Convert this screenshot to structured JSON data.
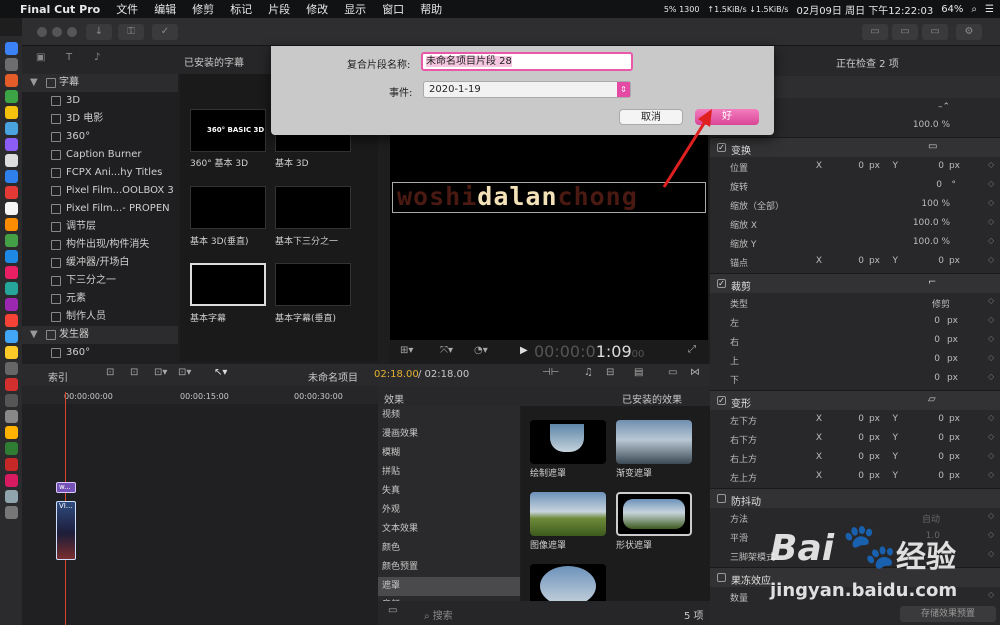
{
  "menubar": {
    "apple": "",
    "app": "Final Cut Pro",
    "items": [
      "文件",
      "编辑",
      "修剪",
      "标记",
      "片段",
      "修改",
      "显示",
      "窗口",
      "帮助"
    ],
    "net": "↑1.5KiB/s ↓1.5KiB/s",
    "cpu": "5% 1300",
    "date": "02月09日 周日 下午12:22:03",
    "battery": "64%"
  },
  "browser": {
    "title": "已安装的字幕",
    "sidebar": [
      {
        "label": "字幕",
        "header": true
      },
      {
        "label": "3D"
      },
      {
        "label": "3D 电影"
      },
      {
        "label": "360°"
      },
      {
        "label": "Caption Burner"
      },
      {
        "label": "FCPX Ani...hy Titles"
      },
      {
        "label": "Pixel Film...OOLBOX 3"
      },
      {
        "label": "Pixel Film...- PROPEN"
      },
      {
        "label": "调节层"
      },
      {
        "label": "构件出现/构件消失"
      },
      {
        "label": "缓冲器/开场白"
      },
      {
        "label": "下三分之一"
      },
      {
        "label": "元素"
      },
      {
        "label": "制作人员"
      },
      {
        "label": "发生器",
        "header": true
      },
      {
        "label": "360°"
      }
    ],
    "thumbs": [
      {
        "label": "360° 基本 3D",
        "preview": "360° BASIC 3D"
      },
      {
        "label": "基本 3D"
      },
      {
        "label": "基本 3D(垂直)"
      },
      {
        "label": "基本下三分之一"
      },
      {
        "label": "基本字幕"
      },
      {
        "label": "基本字幕(垂直)"
      }
    ]
  },
  "dialog": {
    "name_label": "复合片段名称:",
    "name_value": "未命名项目片段 28",
    "event_label": "事件:",
    "event_value": "2020-1-19",
    "cancel": "取消",
    "ok": "好"
  },
  "viewer": {
    "title_text_dim1": "woshi",
    "title_text_bright": "dalan",
    "title_text_dim2": "chong",
    "timecode_dim": "00:00:0",
    "timecode": "1:09",
    "timecode_tail": "00"
  },
  "timeline": {
    "index": "索引",
    "project": "未命名项目",
    "time": "02:18.00",
    "total": "/ 02:18.00",
    "ruler": [
      "00:00:00:00",
      "00:00:15:00",
      "00:00:30:00"
    ],
    "clip_a": "w...",
    "clip_b": "VI..."
  },
  "effects": {
    "header": "效果",
    "installed": "已安装的效果",
    "categories": [
      "视频",
      "漫画效果",
      "模糊",
      "拼贴",
      "失真",
      "外观",
      "文本效果",
      "颜色",
      "颜色预置",
      "遮罩",
      "音频"
    ],
    "selected": "遮罩",
    "items": [
      {
        "label": "绘制遮罩"
      },
      {
        "label": "渐变遮罩"
      },
      {
        "label": "图像遮罩"
      },
      {
        "label": "形状遮罩"
      }
    ],
    "search": "搜索",
    "count": "5 项"
  },
  "inspector": {
    "title": "正在检查 2 项",
    "opacity": "100.0 %",
    "transform": {
      "title": "变换",
      "position": "位置",
      "pos_x": "0",
      "pos_y": "0",
      "rotation": "旋转",
      "rot": "0",
      "scale_all": "缩放（全部）",
      "scale_all_v": "100 %",
      "scale_x": "缩放 X",
      "scale_x_v": "100.0 %",
      "scale_y": "缩放 Y",
      "scale_y_v": "100.0 %",
      "anchor": "锚点",
      "anc_x": "0",
      "anc_y": "0"
    },
    "crop": {
      "title": "裁剪",
      "type": "类型",
      "type_v": "修剪",
      "left": "左",
      "right": "右",
      "top": "上",
      "bottom": "下",
      "val": "0"
    },
    "distort": {
      "title": "变形",
      "bl": "左下方",
      "br": "右下方",
      "tr": "右上方",
      "tl": "左上方",
      "val": "0"
    },
    "stabilize": {
      "title": "防抖动",
      "method": "方法",
      "method_v": "自动",
      "smooth": "平滑",
      "smooth_v": "1.0",
      "tripod": "三脚架模式"
    },
    "freeze": {
      "title": "果冻效应",
      "amount": "数量"
    },
    "save": "存储效果预置",
    "unit_px": "px",
    "unit_deg": "°",
    "x": "X",
    "y": "Y"
  },
  "watermark": {
    "brand": "Bai",
    "brand2": "经验",
    "url": "jingyan.baidu.com"
  }
}
